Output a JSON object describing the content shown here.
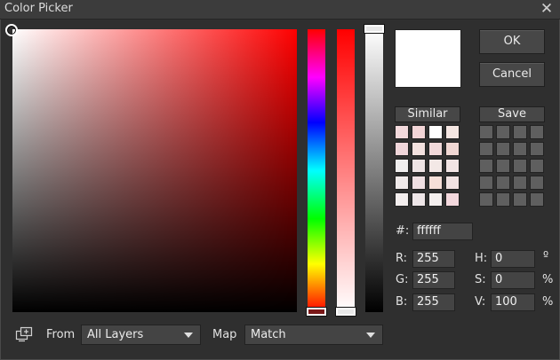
{
  "window": {
    "title": "Color Picker",
    "close_glyph": "✕"
  },
  "buttons": {
    "ok": "OK",
    "cancel": "Cancel",
    "similar": "Similar",
    "save": "Save"
  },
  "current_color": "#ffffff",
  "hex": {
    "label": "#:",
    "value": "ffffff"
  },
  "rgb": {
    "r_label": "R:",
    "r_value": "255",
    "g_label": "G:",
    "g_value": "255",
    "b_label": "B:",
    "b_value": "255"
  },
  "hsv": {
    "h_label": "H:",
    "h_value": "0",
    "h_unit": "º",
    "s_label": "S:",
    "s_value": "0",
    "s_unit": "%",
    "v_label": "V:",
    "v_value": "100",
    "v_unit": "%"
  },
  "bottom": {
    "from_label": "From",
    "from_value": "All Layers",
    "map_label": "Map",
    "map_value": "Match",
    "icon": "eyedropper-screen-icon"
  },
  "similar_swatches": [
    "#f2d9dc",
    "#f1d4d6",
    "#ffffff",
    "#f4e6e2",
    "#f0d6da",
    "#f3e1df",
    "#f1d9da",
    "#f0d7d3",
    "#f0eeee",
    "#ede3e4",
    "#f3e8e6",
    "#f2e4e4",
    "#f0eaea",
    "#efdfe2",
    "#f6dfd8",
    "#f1e2e2",
    "#f3eeee",
    "#eee6e8",
    "#f4efee",
    "#f3d8dd"
  ],
  "save_swatches": [
    "",
    "",
    "",
    "",
    "",
    "",
    "",
    "",
    "",
    "",
    "",
    "",
    "",
    "",
    "",
    "",
    "",
    "",
    "",
    ""
  ],
  "colors": {
    "accent": "#ff0000",
    "panel": "#2f2f2f",
    "control": "#444444"
  }
}
